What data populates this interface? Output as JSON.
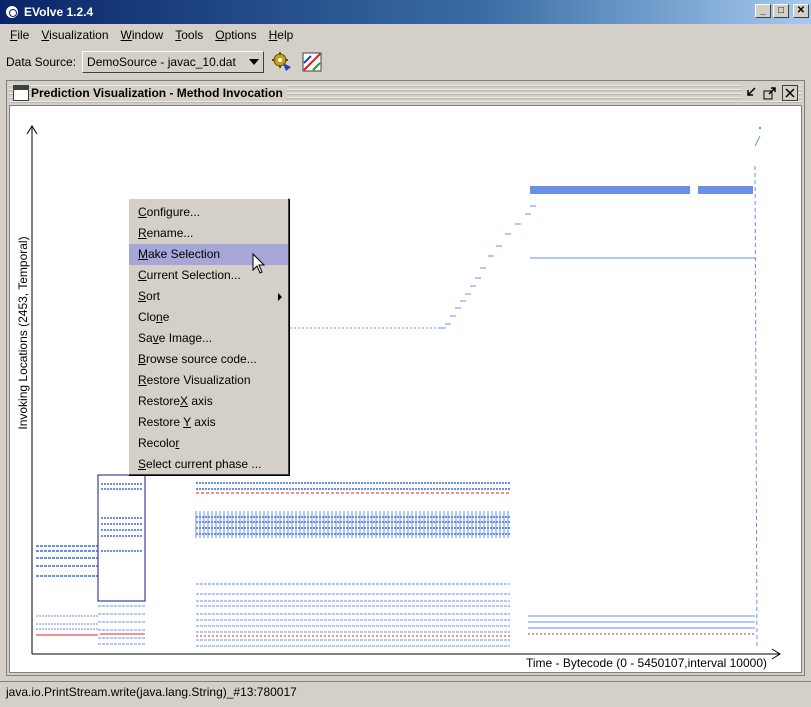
{
  "window": {
    "title": "EVolve 1.2.4",
    "buttons": [
      "_",
      "□",
      "✕"
    ]
  },
  "menu": [
    {
      "label": "File",
      "mn": "F",
      "rest": "ile"
    },
    {
      "label": "Visualization",
      "mn": "V",
      "rest": "isualization"
    },
    {
      "label": "Window",
      "mn": "W",
      "rest": "indow"
    },
    {
      "label": "Tools",
      "mn": "T",
      "rest": "ools"
    },
    {
      "label": "Options",
      "mn": "O",
      "rest": "ptions"
    },
    {
      "label": "Help",
      "mn": "H",
      "rest": "elp"
    }
  ],
  "toolbar": {
    "data_source_label": "Data Source:",
    "data_source_value": "DemoSource - javac_10.dat",
    "icons": [
      "gear-run-icon",
      "visualization-icon"
    ]
  },
  "frame": {
    "title": "Prediction Visualization - Method Invocation"
  },
  "plot": {
    "y_label": "Invoking Locations (2453, Temporal)",
    "x_label": "Time - Bytecode (0 - 5450107,interval 10000)"
  },
  "context_menu": {
    "items": [
      {
        "pre": "",
        "mn": "C",
        "post": "onfigure...",
        "highlighted": false,
        "submenu": false
      },
      {
        "pre": "",
        "mn": "R",
        "post": "ename...",
        "highlighted": false,
        "submenu": false
      },
      {
        "pre": "",
        "mn": "M",
        "post": "ake Selection",
        "highlighted": true,
        "submenu": false
      },
      {
        "pre": "",
        "mn": "C",
        "post": "urrent Selection...",
        "highlighted": false,
        "submenu": false
      },
      {
        "pre": "",
        "mn": "S",
        "post": "ort",
        "highlighted": false,
        "submenu": true
      },
      {
        "pre": "Clo",
        "mn": "n",
        "post": "e",
        "highlighted": false,
        "submenu": false
      },
      {
        "pre": "Sa",
        "mn": "v",
        "post": "e Image...",
        "highlighted": false,
        "submenu": false
      },
      {
        "pre": "",
        "mn": "B",
        "post": "rowse source code...",
        "highlighted": false,
        "submenu": false
      },
      {
        "pre": "",
        "mn": "R",
        "post": "estore Visualization",
        "highlighted": false,
        "submenu": false
      },
      {
        "pre": "Restore",
        "mn": "X",
        "post": " axis",
        "highlighted": false,
        "submenu": false
      },
      {
        "pre": "Restore ",
        "mn": "Y",
        "post": " axis",
        "highlighted": false,
        "submenu": false
      },
      {
        "pre": "Recolo",
        "mn": "r",
        "post": "",
        "highlighted": false,
        "submenu": false
      },
      {
        "pre": "",
        "mn": "S",
        "post": "elect current phase ...",
        "highlighted": false,
        "submenu": false
      }
    ]
  },
  "status": {
    "text": "java.io.PrintStream.write(java.lang.String)_#13:780017"
  },
  "colors": {
    "series_blue": "#6a8fe8",
    "series_red": "#e02020",
    "selection_box": "#1a1a8a",
    "menu_highlight": "#a6a6d8"
  }
}
